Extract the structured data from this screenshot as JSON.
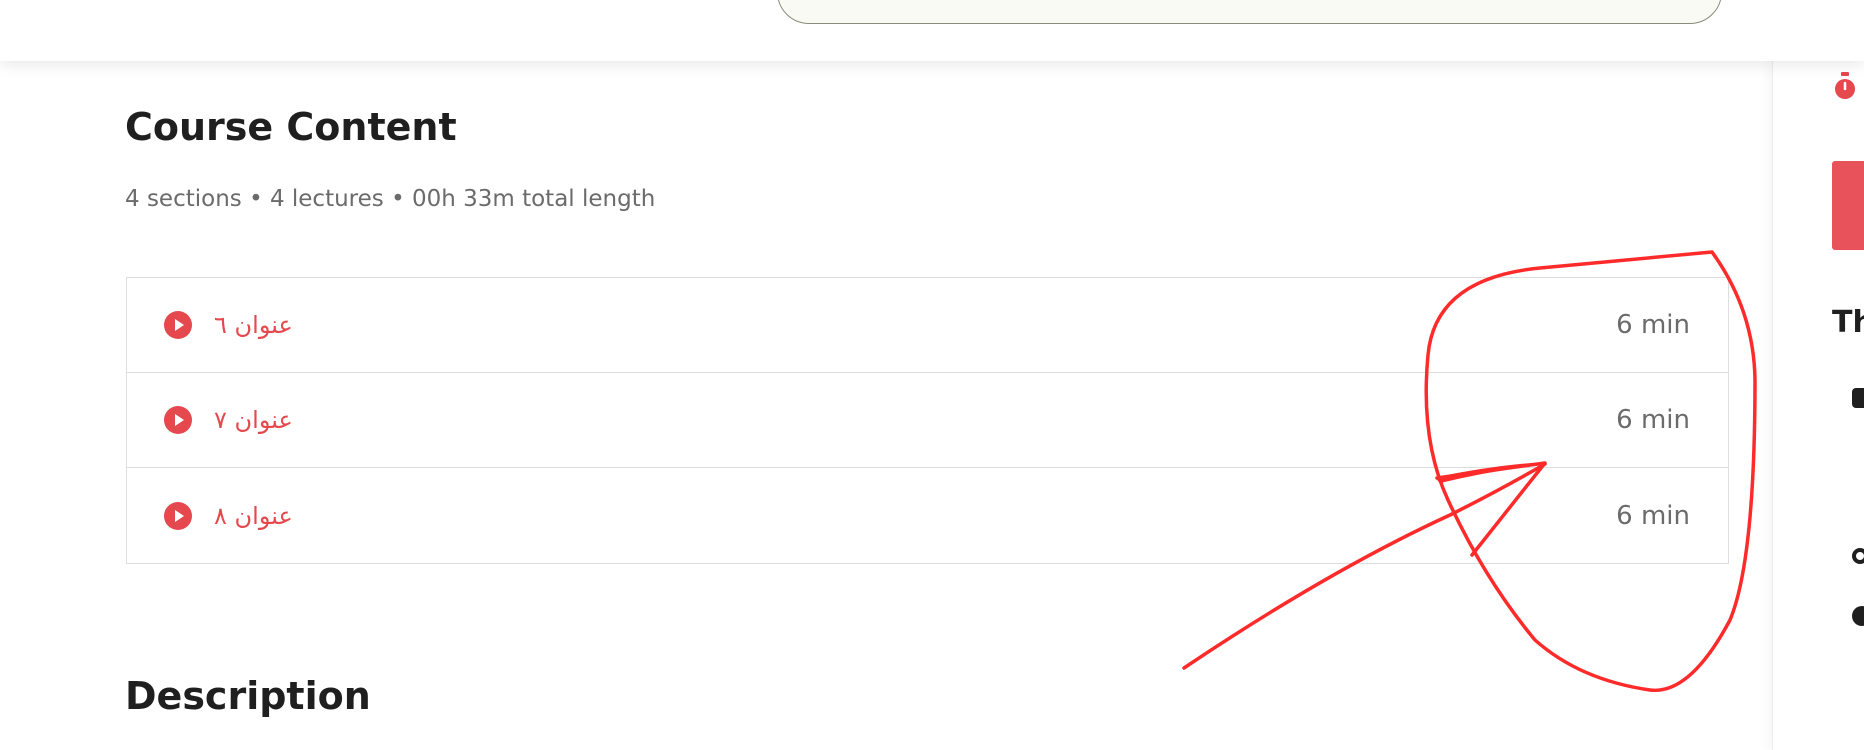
{
  "course_content": {
    "title": "Course Content",
    "meta": "4 sections • 4 lectures • 00h 33m total length",
    "lectures": [
      {
        "title": "عنوان ٦",
        "duration": "6 min",
        "icon": "play-circle-icon"
      },
      {
        "title": "عنوان ٧",
        "duration": "6 min",
        "icon": "play-circle-icon"
      },
      {
        "title": "عنوان ٨",
        "duration": "6 min",
        "icon": "play-circle-icon"
      }
    ]
  },
  "description": {
    "title": "Description"
  },
  "sidebar": {
    "heading": "Th",
    "icons": [
      "timer-icon",
      "feature-icon",
      "feature-icon",
      "feature-icon"
    ]
  },
  "colors": {
    "accent": "#e5484d",
    "annotation": "#ff2a2a",
    "muted_text": "#6b6b6b",
    "border": "#dedede"
  }
}
